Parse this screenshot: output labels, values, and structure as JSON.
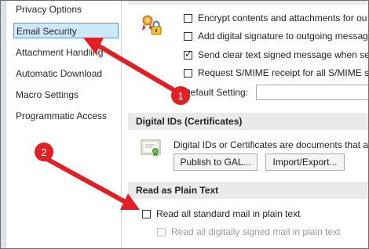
{
  "sidebar": {
    "items": [
      {
        "label": "Privacy Options"
      },
      {
        "label": "Email Security"
      },
      {
        "label": "Attachment Handling"
      },
      {
        "label": "Automatic Download"
      },
      {
        "label": "Macro Settings"
      },
      {
        "label": "Programmatic Access"
      }
    ]
  },
  "encrypted_email": {
    "options": [
      {
        "label": "Encrypt contents and attachments for ou",
        "checked": false
      },
      {
        "label": "Add digital signature to outgoing messag",
        "checked": false
      },
      {
        "label": "Send clear text signed message when sen",
        "checked": true
      },
      {
        "label": "Request S/MIME receipt for all S/MIME si",
        "checked": false
      }
    ],
    "default_setting_label": "Default Setting:"
  },
  "digital_ids": {
    "header": "Digital IDs (Certificates)",
    "description": "Digital IDs or Certificates are documents that al",
    "publish_button": "Publish to GAL...",
    "import_export_button": "Import/Export..."
  },
  "plain_text": {
    "header": "Read as Plain Text",
    "read_all_plain": "Read all standard mail in plain text",
    "read_all_plain_checked": false,
    "read_signed_plain": "Read all digitally signed mail in plain text",
    "read_signed_plain_checked": false
  },
  "annotations": {
    "callout_1": "1",
    "callout_2": "2",
    "accent_color": "#e31f26"
  }
}
